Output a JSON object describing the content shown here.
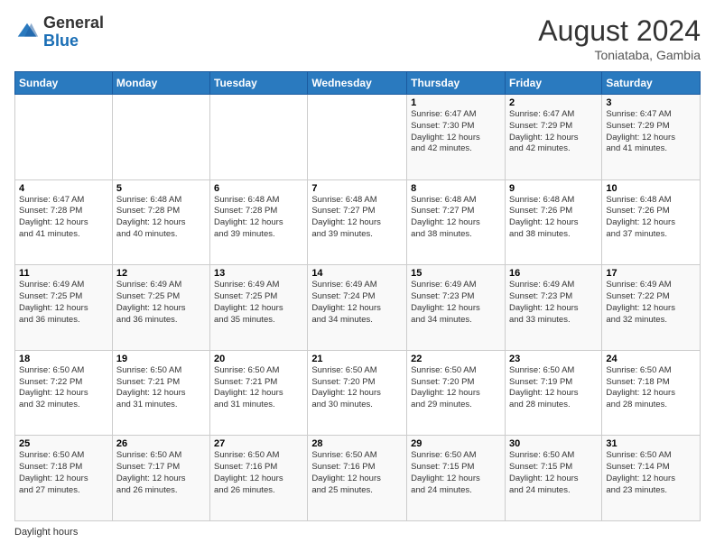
{
  "header": {
    "logo_general": "General",
    "logo_blue": "Blue",
    "month_year": "August 2024",
    "location": "Toniataba, Gambia"
  },
  "footer": {
    "daylight_label": "Daylight hours"
  },
  "days_of_week": [
    "Sunday",
    "Monday",
    "Tuesday",
    "Wednesday",
    "Thursday",
    "Friday",
    "Saturday"
  ],
  "weeks": [
    [
      {
        "day": "",
        "info": ""
      },
      {
        "day": "",
        "info": ""
      },
      {
        "day": "",
        "info": ""
      },
      {
        "day": "",
        "info": ""
      },
      {
        "day": "1",
        "info": "Sunrise: 6:47 AM\nSunset: 7:30 PM\nDaylight: 12 hours\nand 42 minutes."
      },
      {
        "day": "2",
        "info": "Sunrise: 6:47 AM\nSunset: 7:29 PM\nDaylight: 12 hours\nand 42 minutes."
      },
      {
        "day": "3",
        "info": "Sunrise: 6:47 AM\nSunset: 7:29 PM\nDaylight: 12 hours\nand 41 minutes."
      }
    ],
    [
      {
        "day": "4",
        "info": "Sunrise: 6:47 AM\nSunset: 7:28 PM\nDaylight: 12 hours\nand 41 minutes."
      },
      {
        "day": "5",
        "info": "Sunrise: 6:48 AM\nSunset: 7:28 PM\nDaylight: 12 hours\nand 40 minutes."
      },
      {
        "day": "6",
        "info": "Sunrise: 6:48 AM\nSunset: 7:28 PM\nDaylight: 12 hours\nand 39 minutes."
      },
      {
        "day": "7",
        "info": "Sunrise: 6:48 AM\nSunset: 7:27 PM\nDaylight: 12 hours\nand 39 minutes."
      },
      {
        "day": "8",
        "info": "Sunrise: 6:48 AM\nSunset: 7:27 PM\nDaylight: 12 hours\nand 38 minutes."
      },
      {
        "day": "9",
        "info": "Sunrise: 6:48 AM\nSunset: 7:26 PM\nDaylight: 12 hours\nand 38 minutes."
      },
      {
        "day": "10",
        "info": "Sunrise: 6:48 AM\nSunset: 7:26 PM\nDaylight: 12 hours\nand 37 minutes."
      }
    ],
    [
      {
        "day": "11",
        "info": "Sunrise: 6:49 AM\nSunset: 7:25 PM\nDaylight: 12 hours\nand 36 minutes."
      },
      {
        "day": "12",
        "info": "Sunrise: 6:49 AM\nSunset: 7:25 PM\nDaylight: 12 hours\nand 36 minutes."
      },
      {
        "day": "13",
        "info": "Sunrise: 6:49 AM\nSunset: 7:25 PM\nDaylight: 12 hours\nand 35 minutes."
      },
      {
        "day": "14",
        "info": "Sunrise: 6:49 AM\nSunset: 7:24 PM\nDaylight: 12 hours\nand 34 minutes."
      },
      {
        "day": "15",
        "info": "Sunrise: 6:49 AM\nSunset: 7:23 PM\nDaylight: 12 hours\nand 34 minutes."
      },
      {
        "day": "16",
        "info": "Sunrise: 6:49 AM\nSunset: 7:23 PM\nDaylight: 12 hours\nand 33 minutes."
      },
      {
        "day": "17",
        "info": "Sunrise: 6:49 AM\nSunset: 7:22 PM\nDaylight: 12 hours\nand 32 minutes."
      }
    ],
    [
      {
        "day": "18",
        "info": "Sunrise: 6:50 AM\nSunset: 7:22 PM\nDaylight: 12 hours\nand 32 minutes."
      },
      {
        "day": "19",
        "info": "Sunrise: 6:50 AM\nSunset: 7:21 PM\nDaylight: 12 hours\nand 31 minutes."
      },
      {
        "day": "20",
        "info": "Sunrise: 6:50 AM\nSunset: 7:21 PM\nDaylight: 12 hours\nand 31 minutes."
      },
      {
        "day": "21",
        "info": "Sunrise: 6:50 AM\nSunset: 7:20 PM\nDaylight: 12 hours\nand 30 minutes."
      },
      {
        "day": "22",
        "info": "Sunrise: 6:50 AM\nSunset: 7:20 PM\nDaylight: 12 hours\nand 29 minutes."
      },
      {
        "day": "23",
        "info": "Sunrise: 6:50 AM\nSunset: 7:19 PM\nDaylight: 12 hours\nand 28 minutes."
      },
      {
        "day": "24",
        "info": "Sunrise: 6:50 AM\nSunset: 7:18 PM\nDaylight: 12 hours\nand 28 minutes."
      }
    ],
    [
      {
        "day": "25",
        "info": "Sunrise: 6:50 AM\nSunset: 7:18 PM\nDaylight: 12 hours\nand 27 minutes."
      },
      {
        "day": "26",
        "info": "Sunrise: 6:50 AM\nSunset: 7:17 PM\nDaylight: 12 hours\nand 26 minutes."
      },
      {
        "day": "27",
        "info": "Sunrise: 6:50 AM\nSunset: 7:16 PM\nDaylight: 12 hours\nand 26 minutes."
      },
      {
        "day": "28",
        "info": "Sunrise: 6:50 AM\nSunset: 7:16 PM\nDaylight: 12 hours\nand 25 minutes."
      },
      {
        "day": "29",
        "info": "Sunrise: 6:50 AM\nSunset: 7:15 PM\nDaylight: 12 hours\nand 24 minutes."
      },
      {
        "day": "30",
        "info": "Sunrise: 6:50 AM\nSunset: 7:15 PM\nDaylight: 12 hours\nand 24 minutes."
      },
      {
        "day": "31",
        "info": "Sunrise: 6:50 AM\nSunset: 7:14 PM\nDaylight: 12 hours\nand 23 minutes."
      }
    ]
  ]
}
